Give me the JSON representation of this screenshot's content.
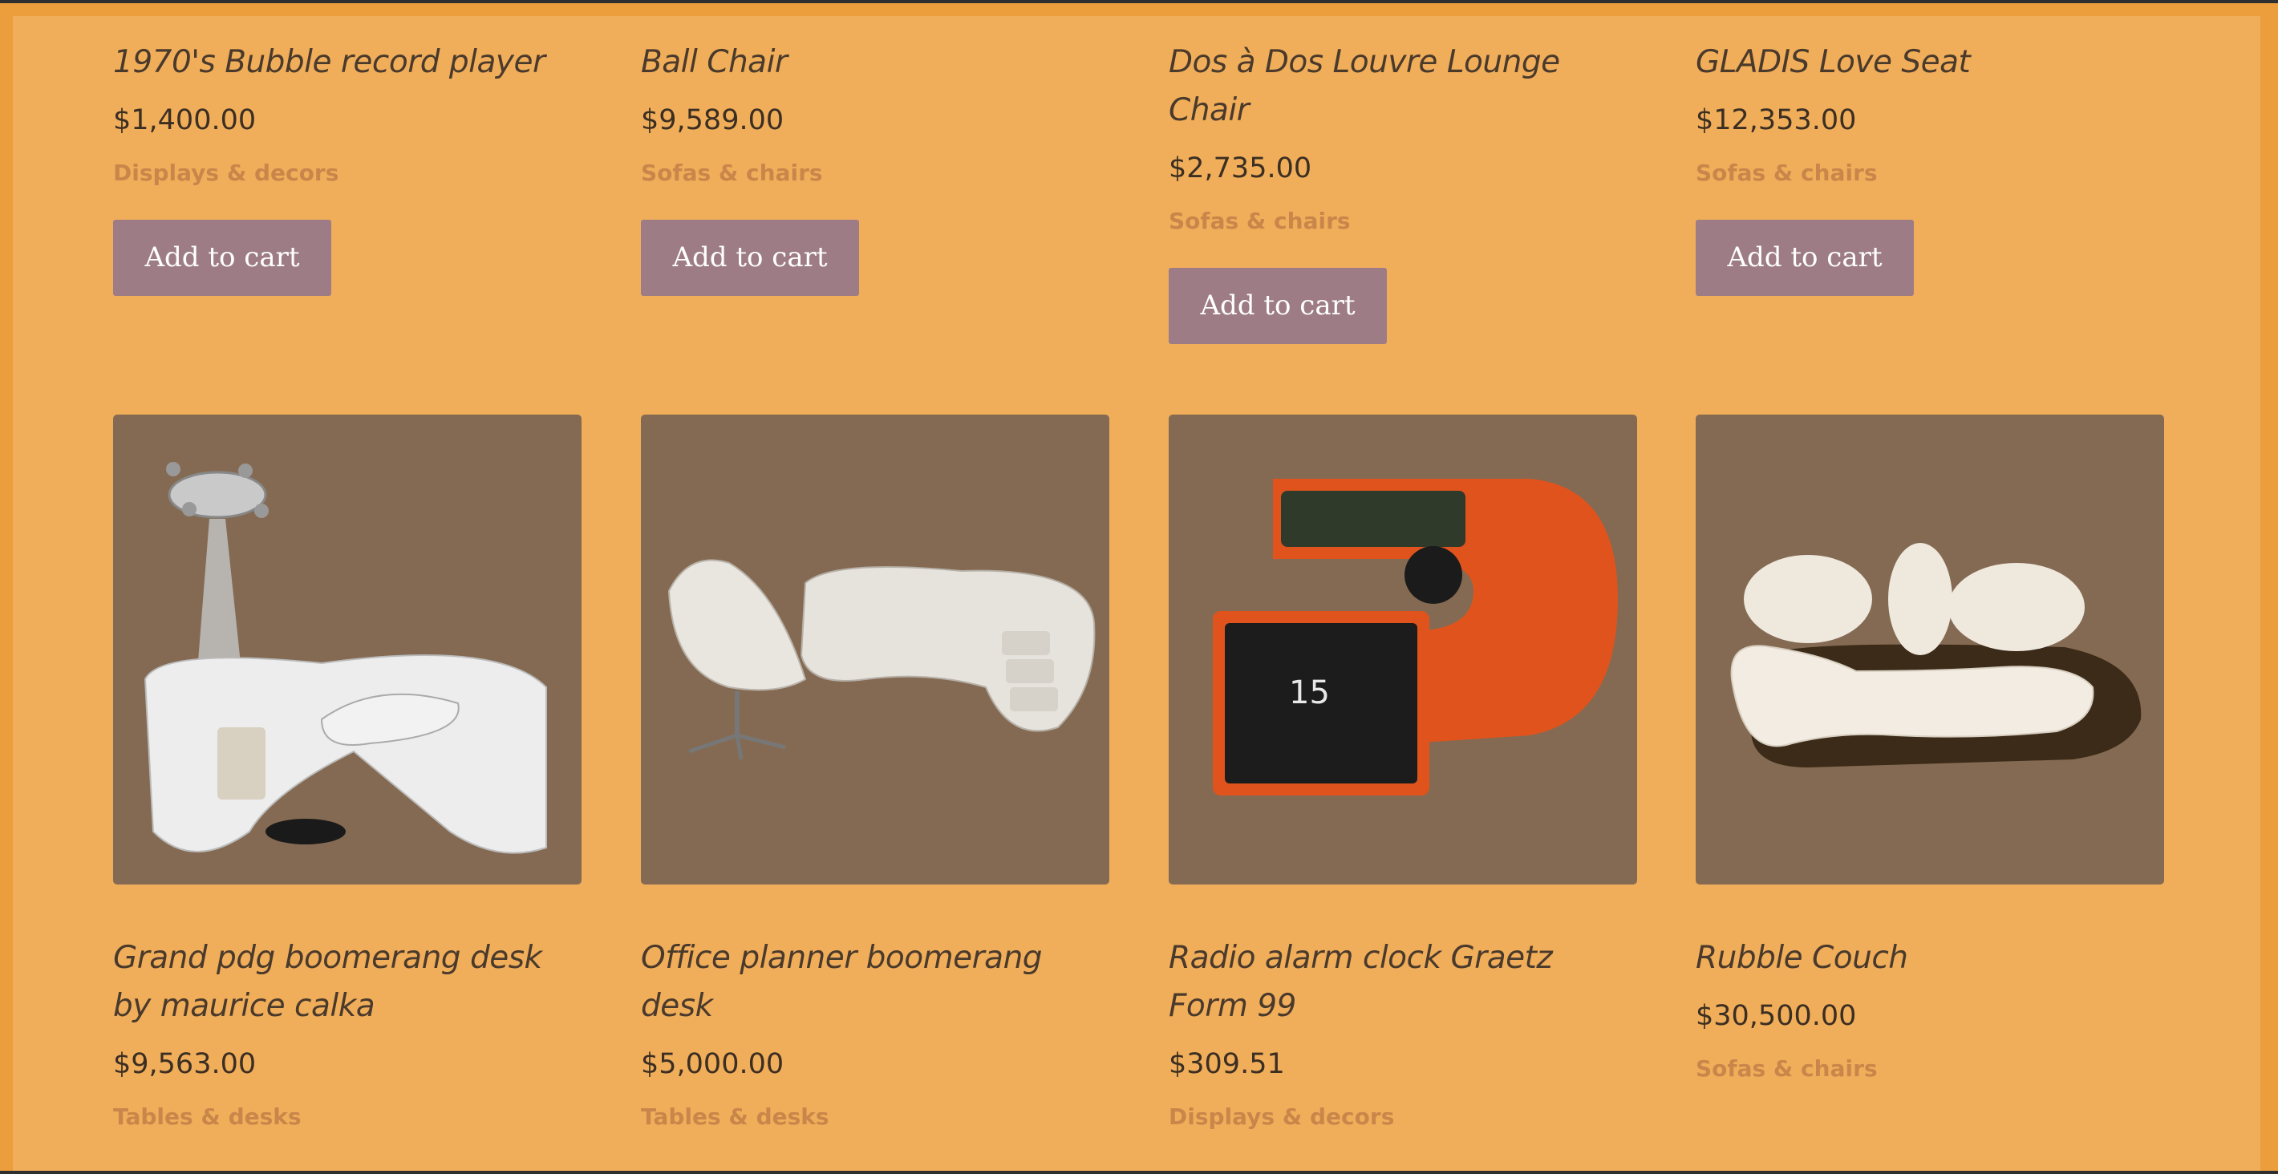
{
  "products_row1": [
    {
      "title": "1970's Bubble record player",
      "price": "$1,400.00",
      "category": "Displays & decors",
      "button": "Add to cart"
    },
    {
      "title": "Ball Chair",
      "price": "$9,589.00",
      "category": "Sofas & chairs",
      "button": "Add to cart"
    },
    {
      "title": "Dos à Dos Louvre Lounge Chair",
      "price": "$2,735.00",
      "category": "Sofas & chairs",
      "button": "Add to cart"
    },
    {
      "title": "GLADIS Love Seat",
      "price": "$12,353.00",
      "category": "Sofas & chairs",
      "button": "Add to cart"
    }
  ],
  "products_row2": [
    {
      "title": "Grand pdg boomerang desk by maurice calka",
      "price": "$9,563.00",
      "category": "Tables & desks"
    },
    {
      "title": "Office planner boomerang desk",
      "price": "$5,000.00",
      "category": "Tables & desks"
    },
    {
      "title": "Radio alarm clock Graetz Form 99",
      "price": "$309.51",
      "category": "Displays & decors"
    },
    {
      "title": "Rubble Couch",
      "price": "$30,500.00",
      "category": "Sofas & chairs"
    }
  ],
  "colors": {
    "page_bg": "#f1ae5a",
    "outer_bg": "#ec9d3c",
    "button_bg": "#9e7c86",
    "image_bg": "#846a52",
    "category_text": "#c9864a"
  }
}
